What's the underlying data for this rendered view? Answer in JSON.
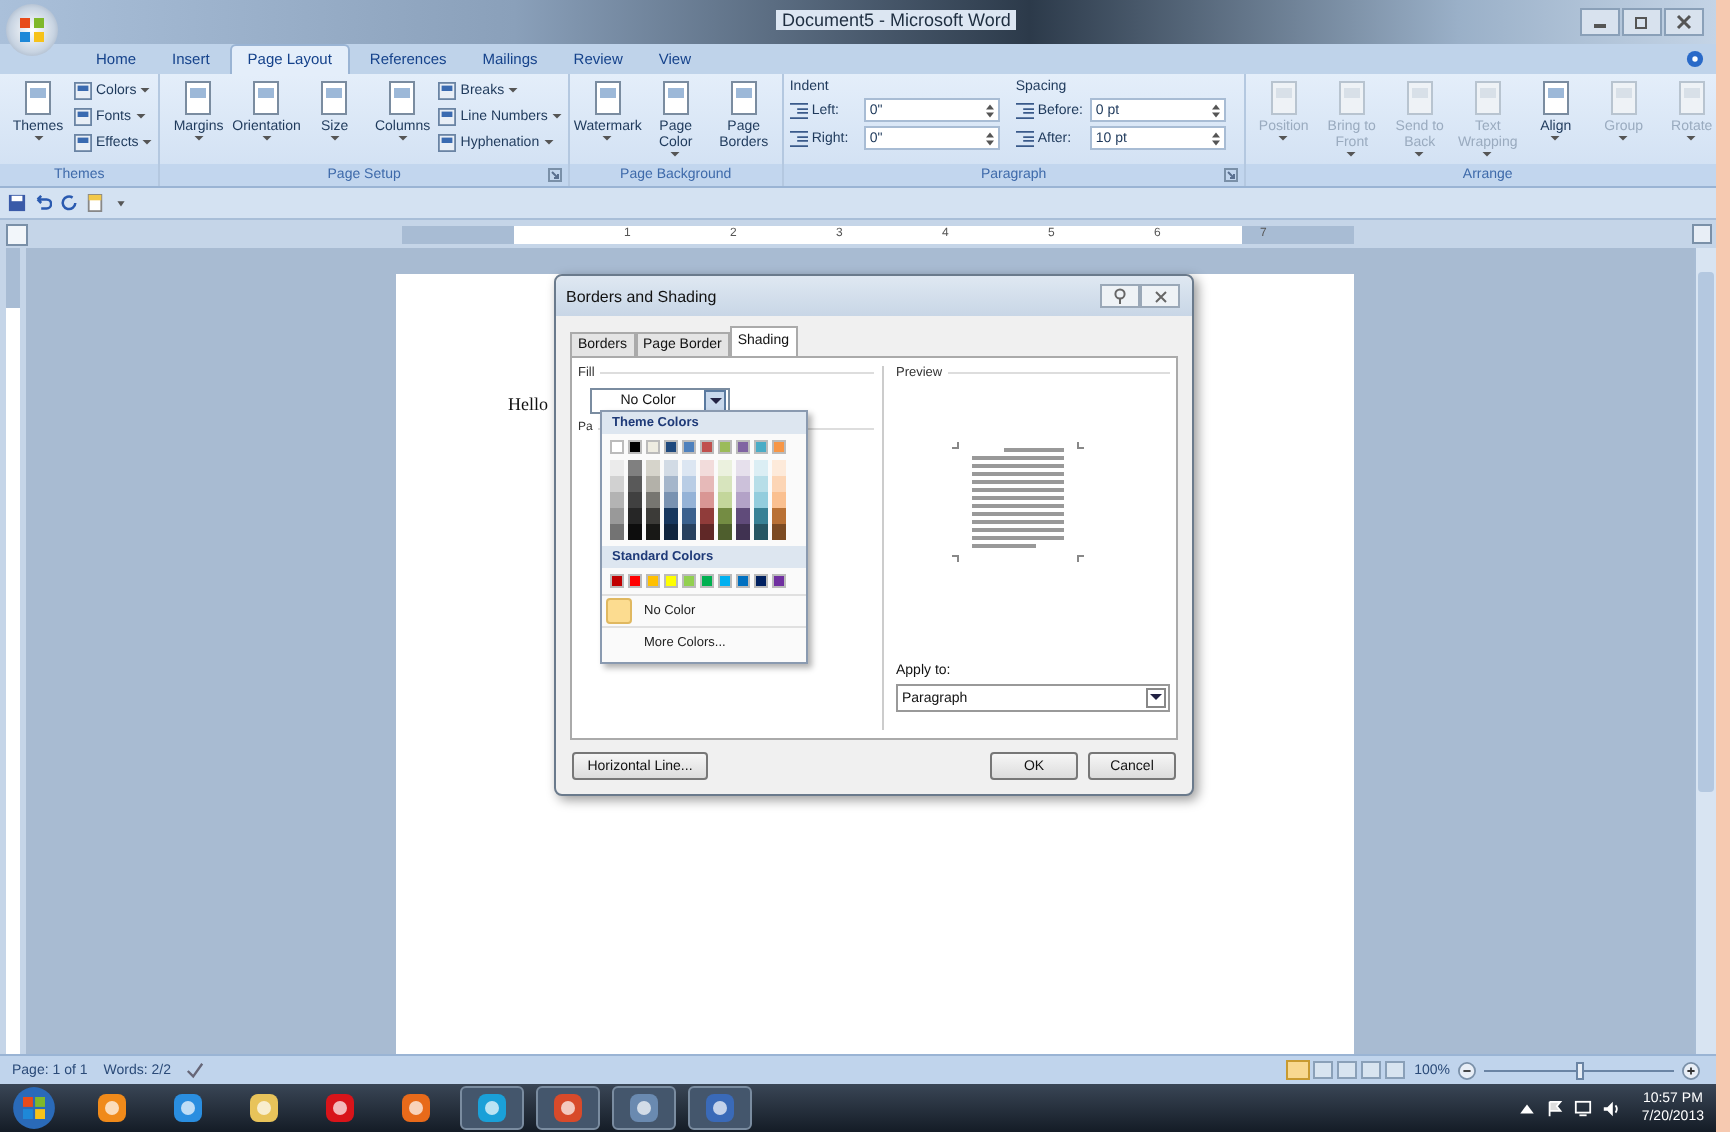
{
  "window": {
    "title": "Document5 - Microsoft Word"
  },
  "tabs": [
    {
      "label": "Home",
      "selected": false
    },
    {
      "label": "Insert",
      "selected": false
    },
    {
      "label": "Page Layout",
      "selected": true
    },
    {
      "label": "References",
      "selected": false
    },
    {
      "label": "Mailings",
      "selected": false
    },
    {
      "label": "Review",
      "selected": false
    },
    {
      "label": "View",
      "selected": false
    }
  ],
  "ribbon": [
    {
      "label": "Themes",
      "kind": "buttons",
      "launcher": false,
      "items": [
        {
          "kind": "large",
          "label": "Themes",
          "dropdown": true,
          "disabled": false
        },
        {
          "kind": "stack",
          "items": [
            {
              "label": "Colors",
              "dropdown": true
            },
            {
              "label": "Fonts",
              "dropdown": true
            },
            {
              "label": "Effects",
              "dropdown": true
            }
          ]
        }
      ]
    },
    {
      "label": "Page Setup",
      "kind": "buttons",
      "launcher": true,
      "items": [
        {
          "kind": "large",
          "label": "Margins",
          "dropdown": true,
          "disabled": false
        },
        {
          "kind": "large",
          "label": "Orientation",
          "dropdown": true,
          "disabled": false
        },
        {
          "kind": "large",
          "label": "Size",
          "dropdown": true,
          "disabled": false
        },
        {
          "kind": "large",
          "label": "Columns",
          "dropdown": true,
          "disabled": false
        },
        {
          "kind": "stack",
          "items": [
            {
              "label": "Breaks",
              "dropdown": true
            },
            {
              "label": "Line Numbers",
              "dropdown": true
            },
            {
              "label": "Hyphenation",
              "dropdown": true
            }
          ]
        }
      ]
    },
    {
      "label": "Page Background",
      "kind": "buttons",
      "launcher": false,
      "items": [
        {
          "kind": "large",
          "label": "Watermark",
          "dropdown": true,
          "disabled": false
        },
        {
          "kind": "large",
          "label": "Page Color",
          "dropdown": true,
          "disabled": false
        },
        {
          "kind": "large",
          "label": "Page Borders",
          "dropdown": false,
          "disabled": false
        }
      ]
    },
    {
      "label": "Paragraph",
      "kind": "fields",
      "launcher": true,
      "columns": [
        {
          "heading": "Indent",
          "fields": [
            {
              "label": "Left:",
              "value": "0\""
            },
            {
              "label": "Right:",
              "value": "0\""
            }
          ]
        },
        {
          "heading": "Spacing",
          "fields": [
            {
              "label": "Before:",
              "value": "0 pt"
            },
            {
              "label": "After:",
              "value": "10 pt"
            }
          ]
        }
      ]
    },
    {
      "label": "Arrange",
      "kind": "buttons",
      "launcher": false,
      "items": [
        {
          "kind": "large",
          "label": "Position",
          "dropdown": true,
          "disabled": true
        },
        {
          "kind": "large",
          "label": "Bring to Front",
          "dropdown": true,
          "disabled": true
        },
        {
          "kind": "large",
          "label": "Send to Back",
          "dropdown": true,
          "disabled": true
        },
        {
          "kind": "large",
          "label": "Text Wrapping",
          "dropdown": true,
          "disabled": true
        },
        {
          "kind": "large",
          "label": "Align",
          "dropdown": true,
          "disabled": false
        },
        {
          "kind": "large",
          "label": "Group",
          "dropdown": true,
          "disabled": true
        },
        {
          "kind": "large",
          "label": "Rotate",
          "dropdown": true,
          "disabled": true
        }
      ]
    }
  ],
  "ruler": {
    "marks": [
      "1",
      "2",
      "3",
      "4",
      "5",
      "6",
      "7"
    ]
  },
  "document": {
    "text": "Hello"
  },
  "dialog": {
    "title": "Borders and Shading",
    "tabs": [
      {
        "label": "Borders",
        "selected": false
      },
      {
        "label": "Page Border",
        "selected": false
      },
      {
        "label": "Shading",
        "selected": true
      }
    ],
    "fill_label": "Fill",
    "fill_value": "No Color",
    "patterns_label": "Pa",
    "preview_label": "Preview",
    "apply_label": "Apply to:",
    "apply_value": "Paragraph",
    "buttons": [
      "Horizontal Line...",
      "OK",
      "Cancel"
    ],
    "palette": {
      "theme_heading": "Theme Colors",
      "theme_colors": [
        {
          "color": "#ffffff"
        },
        {
          "color": "#000000"
        },
        {
          "color": "#eeece1"
        },
        {
          "color": "#1f497d"
        },
        {
          "color": "#4f81bd"
        },
        {
          "color": "#c0504d"
        },
        {
          "color": "#9bbb59"
        },
        {
          "color": "#8064a2"
        },
        {
          "color": "#4bacc6"
        },
        {
          "color": "#f79646"
        }
      ],
      "standard_heading": "Standard Colors",
      "standard_colors": [
        {
          "color": "#c00000"
        },
        {
          "color": "#ff0000"
        },
        {
          "color": "#ffc000"
        },
        {
          "color": "#ffff00"
        },
        {
          "color": "#92d050"
        },
        {
          "color": "#00b050"
        },
        {
          "color": "#00b0f0"
        },
        {
          "color": "#0070c0"
        },
        {
          "color": "#002060"
        },
        {
          "color": "#7030a0"
        }
      ],
      "no_color": "No Color",
      "more_colors": "More Colors..."
    }
  },
  "status_bar": {
    "page": "Page: 1 of 1",
    "words": "Words: 2/2",
    "zoom": "100%",
    "zoom_slider": {
      "level": 0.5
    }
  },
  "taskbar": {
    "time": "10:57 PM",
    "date": "7/20/2013"
  }
}
